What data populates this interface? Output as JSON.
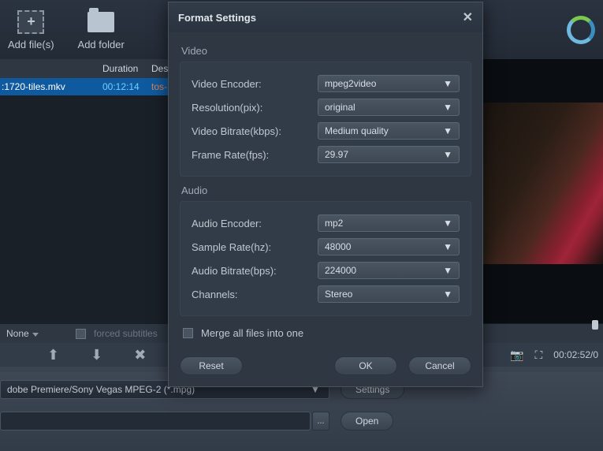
{
  "toolbar": {
    "add_files": "Add file(s)",
    "add_folder": "Add folder"
  },
  "table": {
    "head_duration": "Duration",
    "head_dest": "Dest",
    "row": {
      "name": ":1720-tiles.mkv",
      "duration": "00:12:14",
      "dest": "tos-"
    }
  },
  "subtitles": {
    "selector": "None",
    "label": "forced subtitles"
  },
  "preview": {
    "timestamp": "00:02:52/0"
  },
  "profile": {
    "value": "dobe Premiere/Sony Vegas MPEG-2 (*.mpg)",
    "settings_btn": "Settings",
    "open_btn": "Open",
    "browse_btn": "..."
  },
  "dialog": {
    "title": "Format Settings",
    "video_section": "Video",
    "audio_section": "Audio",
    "video_encoder_label": "Video Encoder:",
    "video_encoder_value": "mpeg2video",
    "resolution_label": "Resolution(pix):",
    "resolution_value": "original",
    "video_bitrate_label": "Video Bitrate(kbps):",
    "video_bitrate_value": "Medium quality",
    "frame_rate_label": "Frame Rate(fps):",
    "frame_rate_value": "29.97",
    "audio_encoder_label": "Audio Encoder:",
    "audio_encoder_value": "mp2",
    "sample_rate_label": "Sample Rate(hz):",
    "sample_rate_value": "48000",
    "audio_bitrate_label": "Audio Bitrate(bps):",
    "audio_bitrate_value": "224000",
    "channels_label": "Channels:",
    "channels_value": "Stereo",
    "merge_label": "Merge all files into one",
    "reset_btn": "Reset",
    "ok_btn": "OK",
    "cancel_btn": "Cancel"
  }
}
